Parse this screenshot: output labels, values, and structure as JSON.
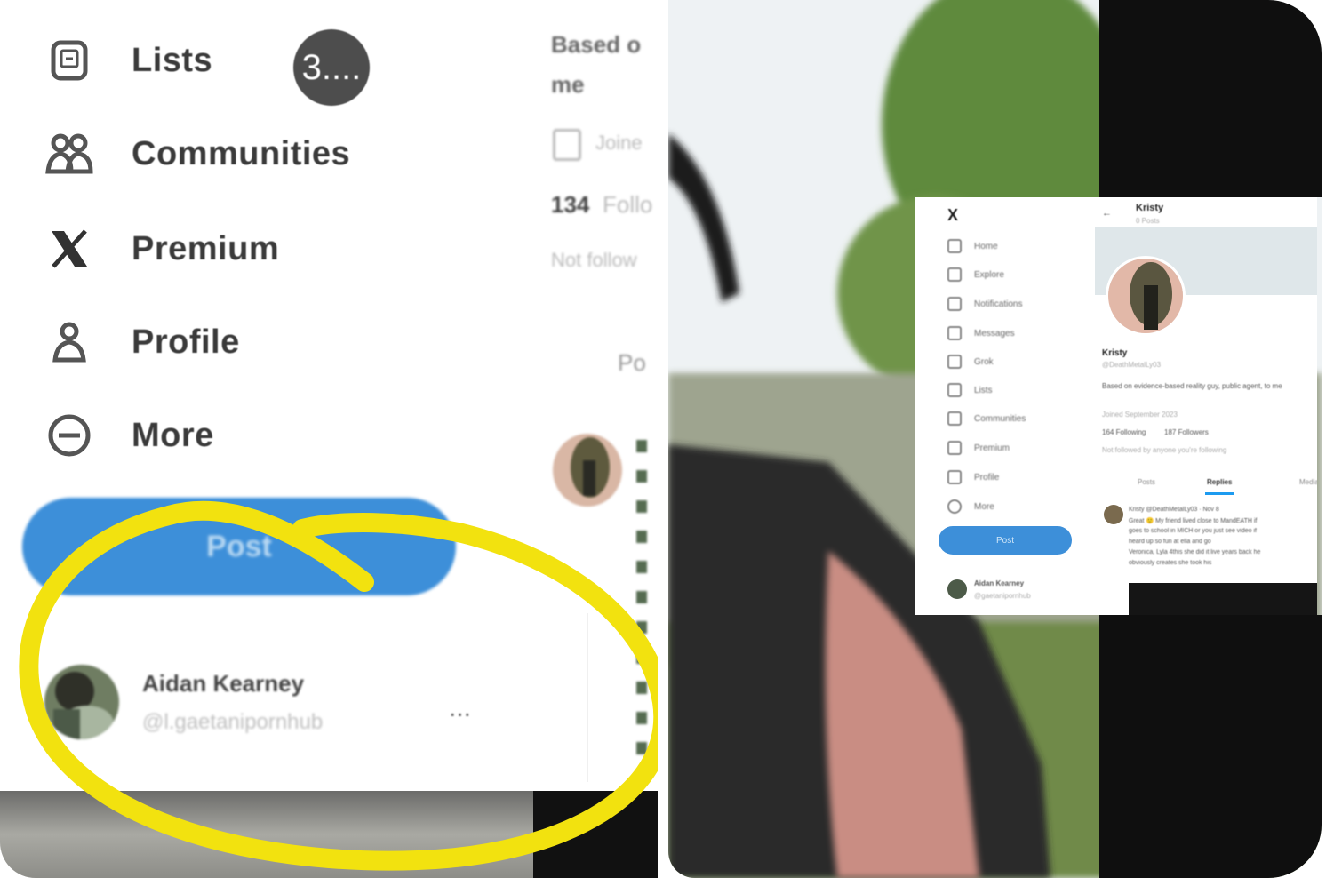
{
  "nav": {
    "items": [
      {
        "label": "Lists",
        "icon": "list-icon"
      },
      {
        "label": "Communities",
        "icon": "communities-icon"
      },
      {
        "label": "Premium",
        "icon": "x-logo-icon"
      },
      {
        "label": "Profile",
        "icon": "profile-icon"
      },
      {
        "label": "More",
        "icon": "more-circle-icon"
      }
    ],
    "badge": "3....",
    "post_label": "Post"
  },
  "account": {
    "name": "Aidan Kearney",
    "handle": "@l.gaetanipornhub",
    "more": "..."
  },
  "side_profile": {
    "bio_line1": "Based o",
    "bio_line2": "me",
    "joined": "Joine",
    "followers_count": "134",
    "followers_label": "Follo",
    "not_followed": "Not follow",
    "tab_partial": "Po"
  },
  "colors": {
    "highlight": "#f2e20f",
    "post_button": "#3d8fd9",
    "x_blue": "#1d9bf0"
  },
  "mini_screenshot": {
    "profile_name": "Kristy",
    "posts_count": "0 Posts",
    "handle": "@DeathMetalLy03",
    "bio": "Based on evidence-based reality guy, public agent, to me",
    "joined": "Joined September 2023",
    "following": "164 Following",
    "followers": "187 Followers",
    "not_followed": "Not followed by anyone you're following",
    "tabs": [
      "Posts",
      "Replies",
      "Media"
    ],
    "nav_items": [
      "Home",
      "Explore",
      "Notifications",
      "Messages",
      "Grok",
      "Lists",
      "Communities",
      "Premium",
      "Profile",
      "More"
    ],
    "post_label": "Post",
    "account_name": "Aidan Kearney",
    "account_handle": "@gaetanipornhub",
    "tweet_lines": [
      "Kristy @DeathMetalLy03 · Nov 8",
      "Great 🙂 My friend lived close to MandEATH if",
      "goes to school in MICH or you just see video if",
      "heard up so fun at ella and go",
      "Veronica, Lyla 4this she did it live years back he",
      "obviously creates she took his"
    ]
  }
}
